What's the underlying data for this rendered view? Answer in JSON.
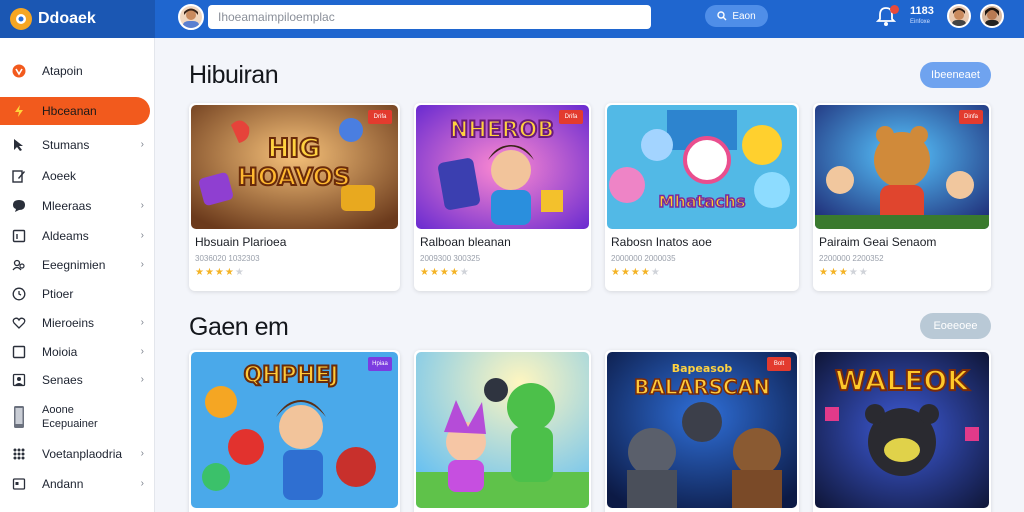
{
  "app": {
    "brand": "Ddoaek"
  },
  "search": {
    "placeholder": "Ihoeamaimpiloemplac",
    "button": "Eaon"
  },
  "top": {
    "count": "1183",
    "count_sub": "Einfoxe"
  },
  "sidebar": {
    "items": [
      {
        "label": "Atapoin",
        "icon": "shield-icon",
        "chevron": false,
        "active": false
      },
      {
        "label": "Hbceanan",
        "icon": "lightning-icon",
        "chevron": false,
        "active": true
      },
      {
        "label": "Stumans",
        "icon": "cursor-icon",
        "chevron": true,
        "active": false
      },
      {
        "label": "Aoeek",
        "icon": "pencil-icon",
        "chevron": false,
        "active": false
      },
      {
        "label": "Mleeraas",
        "icon": "speech-bubble-icon",
        "chevron": true,
        "active": false
      },
      {
        "label": "Aldeams",
        "icon": "clipboard-icon",
        "chevron": true,
        "active": false
      },
      {
        "label": "Eeegnimien",
        "icon": "users-icon",
        "chevron": true,
        "active": false
      },
      {
        "label": "Ptioer",
        "icon": "clock-icon",
        "chevron": false,
        "active": false
      },
      {
        "label": "Mieroeins",
        "icon": "heart-icon",
        "chevron": true,
        "active": false
      },
      {
        "label": "Moioia",
        "icon": "square-icon",
        "chevron": true,
        "active": false
      },
      {
        "label": "Senaes",
        "icon": "user-icon",
        "chevron": true,
        "active": false
      },
      {
        "label": "Aoone",
        "label2": "Ecepuainer",
        "icon": "phone-icon",
        "chevron": false,
        "active": false
      },
      {
        "label": "Voetanplaodria",
        "icon": "grid-icon",
        "chevron": true,
        "active": false
      },
      {
        "label": "Andann",
        "icon": "card-icon",
        "chevron": true,
        "active": false
      }
    ]
  },
  "sections": [
    {
      "title": "Hibuiran",
      "button": "Ibeeneaet",
      "cards": [
        {
          "name": "Hbsuain Plarioea",
          "sub": "3036020 1032303",
          "rating": 4.5,
          "badge": "Drifa",
          "thumb_title": [
            "HIG",
            "HOAVOS"
          ]
        },
        {
          "name": "Ralboan bleanan",
          "sub": "2009300 300325",
          "rating": 4.5,
          "badge": "Drifa",
          "thumb_title": [
            "NHEROB"
          ]
        },
        {
          "name": "Rabosn Inatos aoe",
          "sub": "2000000 2000035",
          "rating": 4,
          "badge": "",
          "thumb_title": [
            "Mhatachs"
          ]
        },
        {
          "name": "Pairaim Geai Senaom",
          "sub": "2200000 2200352",
          "rating": 3.5,
          "badge": "Dinfa",
          "thumb_title": []
        }
      ]
    },
    {
      "title": "Gaen em",
      "button": "Eoeeoee",
      "cards": [
        {
          "name": "",
          "sub": "",
          "rating": 0,
          "badge": "Hpiaa",
          "thumb_title": [
            "QHPHEJ"
          ]
        },
        {
          "name": "",
          "sub": "",
          "rating": 0,
          "badge": "",
          "thumb_title": []
        },
        {
          "name": "",
          "sub": "",
          "rating": 0,
          "badge": "Bolt",
          "thumb_title": [
            "Bapeasob",
            "BALARSCAN"
          ]
        },
        {
          "name": "",
          "sub": "",
          "rating": 0,
          "badge": "",
          "thumb_title": [
            "WALEOK"
          ]
        }
      ]
    }
  ],
  "colors": {
    "topbar": "#1f66cf",
    "accent": "#f25a1d",
    "star": "#f4b325",
    "badge": "#e33b2e"
  }
}
